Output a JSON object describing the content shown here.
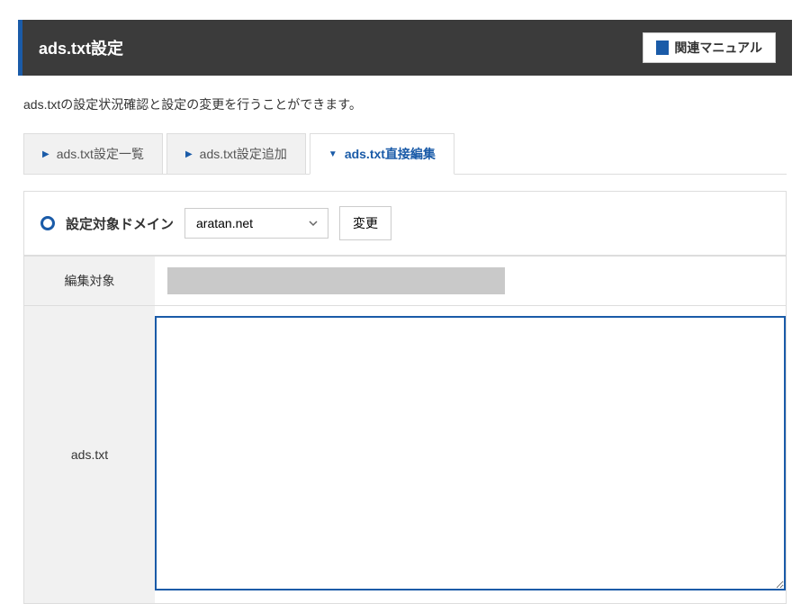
{
  "header": {
    "title": "ads.txt設定",
    "manual_label": "関連マニュアル"
  },
  "description": "ads.txtの設定状況確認と設定の変更を行うことができます。",
  "tabs": [
    {
      "label": "ads.txt設定一覧",
      "active": false
    },
    {
      "label": "ads.txt設定追加",
      "active": false
    },
    {
      "label": "ads.txt直接編集",
      "active": true
    }
  ],
  "domain_section": {
    "label": "設定対象ドメイン",
    "selected": "aratan.net",
    "change_button": "変更"
  },
  "form": {
    "target_label": "編集対象",
    "target_value": "",
    "adstxt_label": "ads.txt",
    "adstxt_value": ""
  }
}
